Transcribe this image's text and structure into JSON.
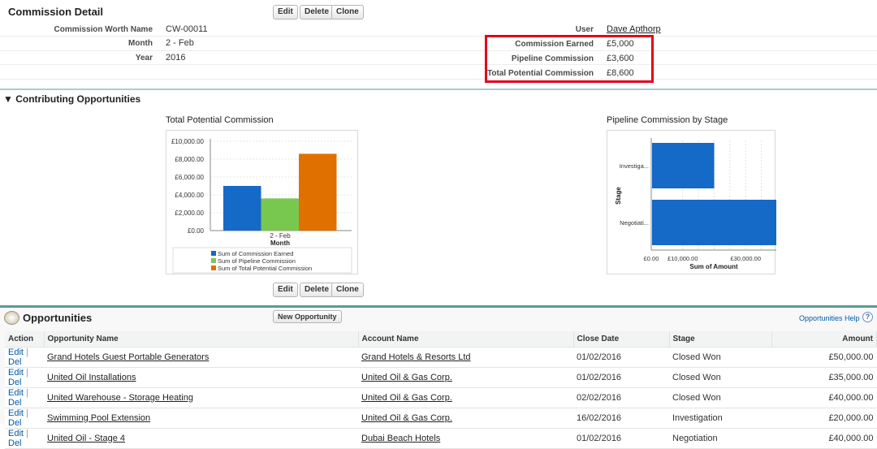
{
  "detail": {
    "title": "Commission Detail",
    "buttons": {
      "edit": "Edit",
      "delete": "Delete",
      "clone": "Clone"
    },
    "fields": [
      {
        "label": "Commission Worth Name",
        "value": "CW-00011"
      },
      {
        "label": "Month",
        "value": "2 - Feb"
      },
      {
        "label": "Year",
        "value": "2016"
      }
    ],
    "right_fields": [
      {
        "label": "User",
        "value": "Dave Apthorp"
      },
      {
        "label": "Commission Earned",
        "value": "£5,000"
      },
      {
        "label": "Pipeline Commission",
        "value": "£3,600"
      },
      {
        "label": "Total Potential Commission",
        "value": "£8,600"
      }
    ],
    "highlight_color": "#e3001b"
  },
  "contributing": {
    "title": "Contributing Opportunities",
    "buttons": {
      "edit": "Edit",
      "delete": "Delete",
      "clone": "Clone"
    }
  },
  "chart_data": [
    {
      "type": "bar",
      "title": "Total Potential Commission",
      "xlabel": "Month",
      "ylabel": "",
      "categories": [
        "2 - Feb"
      ],
      "ylim": [
        0,
        10000
      ],
      "yticks": [
        "£0.00",
        "£2,000.00",
        "£4,000.00",
        "£6,000.00",
        "£8,000.00",
        "£10,000.00"
      ],
      "series": [
        {
          "name": "Sum of Commission Earned",
          "values": [
            5000
          ],
          "color": "#1569c7"
        },
        {
          "name": "Sum of Pipeline Commission",
          "values": [
            3600
          ],
          "color": "#78c850"
        },
        {
          "name": "Sum of Total Potential Commission",
          "values": [
            8600
          ],
          "color": "#e07000"
        }
      ],
      "legend": "bottom"
    },
    {
      "type": "bar",
      "orientation": "horizontal",
      "title": "Pipeline Commission by Stage",
      "xlabel": "Sum of Amount",
      "ylabel": "Stage",
      "categories": [
        "Investiga...",
        "Negotiati..."
      ],
      "values": [
        20000,
        40000
      ],
      "xlim": [
        0,
        40000
      ],
      "xticks": [
        {
          "v": 0,
          "label": "£0.00"
        },
        {
          "v": 10000,
          "label": "£10,000.00"
        },
        {
          "v": 30000,
          "label": "£30,000.00"
        }
      ],
      "color": "#1569c7"
    }
  ],
  "opportunities": {
    "title": "Opportunities",
    "new_button": "New Opportunity",
    "help": "Opportunities Help",
    "help_icon": "?",
    "columns": [
      "Action",
      "Opportunity Name",
      "Account Name",
      "Close Date",
      "Stage",
      "Amount"
    ],
    "rows": [
      {
        "edit": "Edit",
        "del": "Del",
        "name": "Grand Hotels Guest Portable Generators",
        "account": "Grand Hotels & Resorts Ltd",
        "date": "01/02/2016",
        "stage": "Closed Won",
        "amount": "£50,000.00"
      },
      {
        "edit": "Edit",
        "del": "Del",
        "name": "United Oil Installations",
        "account": "United Oil & Gas Corp.",
        "date": "01/02/2016",
        "stage": "Closed Won",
        "amount": "£35,000.00"
      },
      {
        "edit": "Edit",
        "del": "Del",
        "name": "United Warehouse - Storage Heating",
        "account": "United Oil & Gas Corp.",
        "date": "02/02/2016",
        "stage": "Closed Won",
        "amount": "£40,000.00"
      },
      {
        "edit": "Edit",
        "del": "Del",
        "name": "Swimming Pool Extension",
        "account": "United Oil & Gas Corp.",
        "date": "16/02/2016",
        "stage": "Investigation",
        "amount": "£20,000.00"
      },
      {
        "edit": "Edit",
        "del": "Del",
        "name": "United Oil - Stage 4",
        "account": "Dubai Beach Hotels",
        "date": "01/02/2016",
        "stage": "Negotiation",
        "amount": "£40,000.00"
      }
    ]
  }
}
